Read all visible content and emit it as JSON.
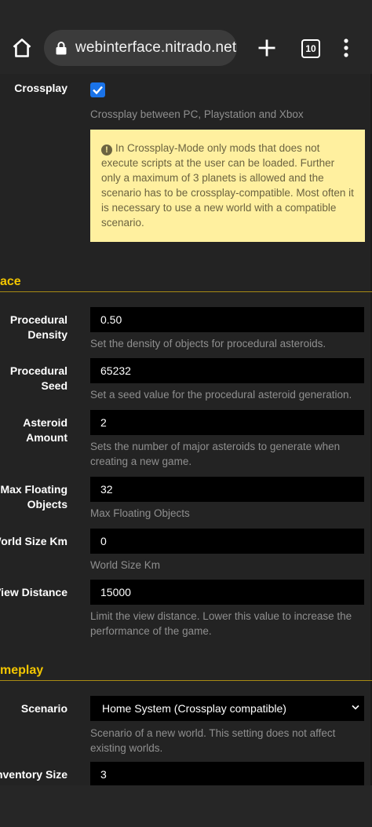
{
  "browser": {
    "url": "webinterface.nitrado.net",
    "tab_count": "10"
  },
  "crossplay": {
    "label": "Crossplay",
    "checked": true,
    "description": "Crossplay between PC, Playstation and Xbox",
    "warning": "In Crossplay-Mode only mods that does not execute scripts at the user can be loaded. Further only a maximum of 3 planets is allowed and the scenario has to be crossplay-compatible. Most often it is necessary to use a new world with a compatible scenario."
  },
  "sections": {
    "space": "ace",
    "gameplay": "meplay"
  },
  "fields": {
    "procedural_density": {
      "label": "Procedural Density",
      "value": "0.50",
      "description": "Set the density of objects for procedural asteroids."
    },
    "procedural_seed": {
      "label": "Procedural Seed",
      "value": "65232",
      "description": "Set a seed value for the procedural asteroid generation."
    },
    "asteroid_amount": {
      "label": "Asteroid Amount",
      "value": "2",
      "description": "Sets the number of major asteroids to generate when creating a new game."
    },
    "max_floating_objects": {
      "label": "Max Floating Objects",
      "value": "32",
      "description": "Max Floating Objects"
    },
    "world_size_km": {
      "label": "World Size Km",
      "value": "0",
      "description": "World Size Km"
    },
    "view_distance": {
      "label": "View Distance",
      "value": "15000",
      "description": "Limit the view distance. Lower this value to increase the performance of the game."
    },
    "scenario": {
      "label": "Scenario",
      "value": "Home System (Crossplay compatible)",
      "description": "Scenario of a new world. This setting does not affect existing worlds."
    },
    "inventory_size": {
      "label": "Inventory Size",
      "value": "3"
    }
  }
}
